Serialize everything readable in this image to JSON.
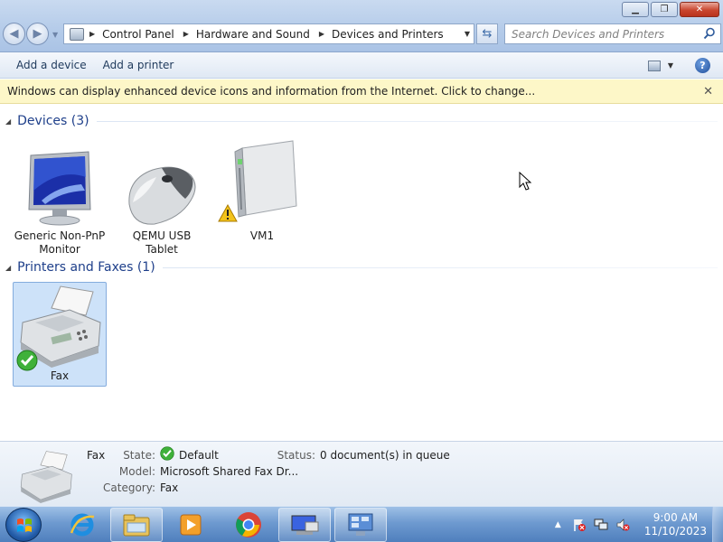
{
  "window": {
    "minimize_label": "▁",
    "maximize_label": "❐",
    "close_label": "✕"
  },
  "navigation": {
    "back_label": "◀",
    "forward_label": "▶",
    "breadcrumbs": [
      "Control Panel",
      "Hardware and Sound",
      "Devices and Printers"
    ],
    "search_placeholder": "Search Devices and Printers"
  },
  "toolbar": {
    "add_device_label": "Add a device",
    "add_printer_label": "Add a printer"
  },
  "infobar": {
    "message": "Windows can display enhanced device icons and information from the Internet. Click to change..."
  },
  "groups": {
    "devices": {
      "title": "Devices (3)",
      "items": [
        {
          "label_line1": "Generic Non-PnP",
          "label_line2": "Monitor",
          "icon": "monitor-icon"
        },
        {
          "label_line1": "QEMU USB",
          "label_line2": "Tablet",
          "icon": "mouse-icon"
        },
        {
          "label_line1": "VM1",
          "label_line2": "",
          "icon": "computer-tower-icon",
          "warning": true
        }
      ]
    },
    "printers": {
      "title": "Printers and Faxes (1)",
      "items": [
        {
          "label_line1": "Fax",
          "icon": "fax-icon",
          "default": true,
          "selected": true
        }
      ]
    }
  },
  "details": {
    "name": "Fax",
    "state_label": "State:",
    "state_value": "Default",
    "status_label": "Status:",
    "status_value": "0 document(s) in queue",
    "model_label": "Model:",
    "model_value": "Microsoft Shared Fax Dr...",
    "category_label": "Category:",
    "category_value": "Fax"
  },
  "taskbar": {
    "apps": [
      "internet-explorer-icon",
      "file-explorer-icon",
      "media-player-icon",
      "chrome-icon",
      "devices-printers-icon",
      "control-panel-icon"
    ],
    "time": "9:00 AM",
    "date": "11/10/2023"
  }
}
